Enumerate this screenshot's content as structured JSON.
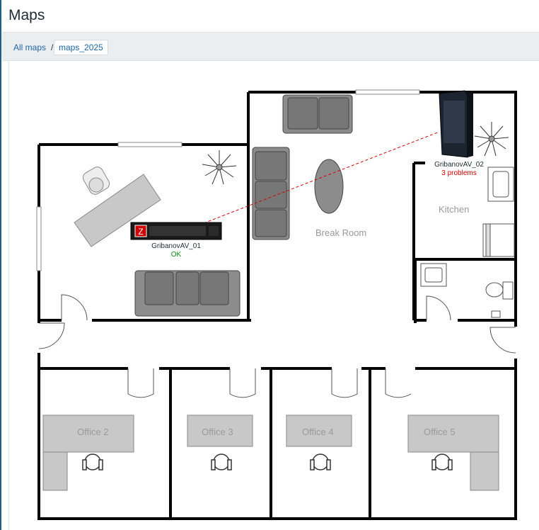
{
  "page": {
    "title": "Maps"
  },
  "breadcrumb": {
    "root": "All maps",
    "separator": "/",
    "current": "maps_2025"
  },
  "map": {
    "rooms": {
      "break_room": "Break Room",
      "kitchen": "Kitchen",
      "office_2": "Office 2",
      "office_3": "Office 3",
      "office_4": "Office 4",
      "office_5": "Office 5"
    },
    "hosts": [
      {
        "name": "GribanovAV_01",
        "status": "OK",
        "icon": "rack-server-icon"
      },
      {
        "name": "GribanovAV_02",
        "status": "3 problems",
        "icon": "tower-server-icon"
      }
    ],
    "link": {
      "style": "dashed",
      "color": "#d40000"
    },
    "colors": {
      "ok": "#0b8a1a",
      "problem": "#d40000",
      "link": "#1f65a6"
    }
  }
}
